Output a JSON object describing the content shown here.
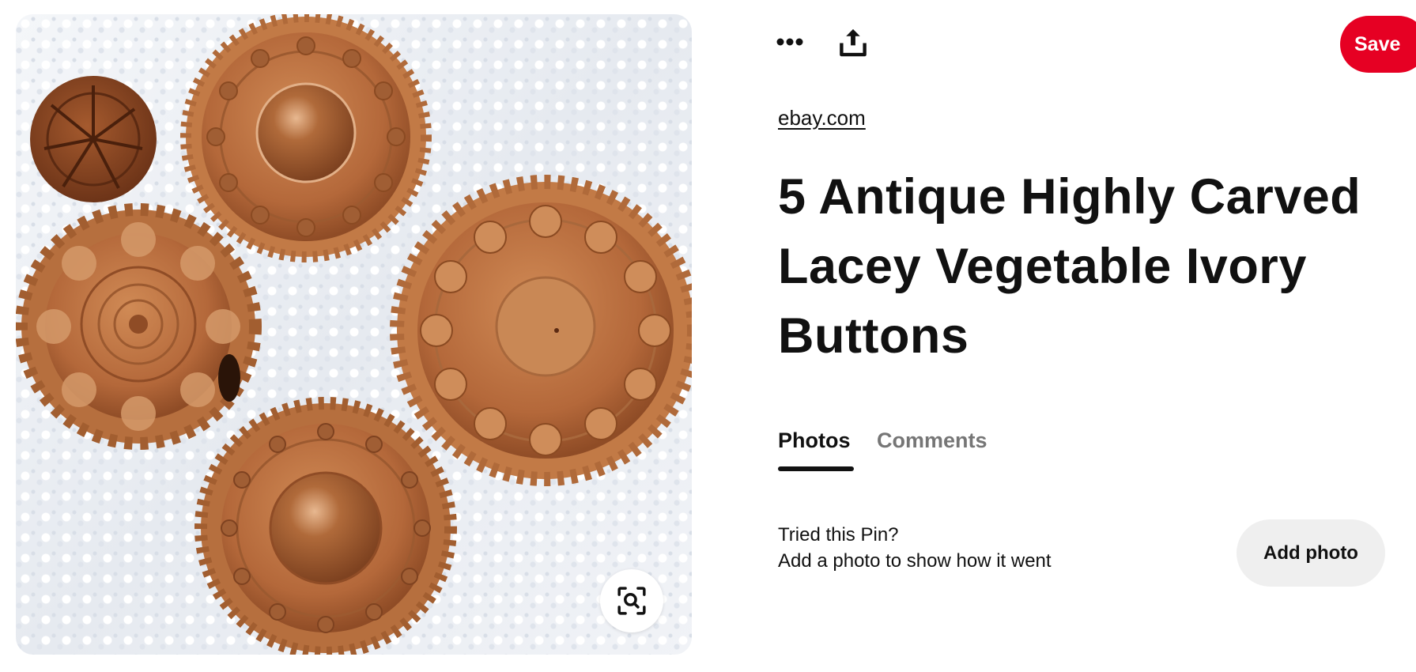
{
  "pin_image": {
    "alt": "",
    "lens_icon": "visual-search-icon"
  },
  "toolbar": {
    "more_icon": "ellipsis-icon",
    "share_icon": "share-upload-icon",
    "save_label": "Save"
  },
  "source": {
    "domain": "ebay.com"
  },
  "pin": {
    "title": "5 Antique Highly Carved Lacey Vegetable Ivory Buttons"
  },
  "tabs": [
    {
      "label": "Photos",
      "active": true
    },
    {
      "label": "Comments",
      "active": false
    }
  ],
  "tried": {
    "question": "Tried this Pin?",
    "prompt": "Add a photo to show how it went",
    "button_label": "Add photo"
  },
  "colors": {
    "save_red": "#e60023",
    "text_primary": "#111111",
    "text_secondary": "#767676",
    "button_gray": "#efefef",
    "button_brown": "#b86a38"
  }
}
